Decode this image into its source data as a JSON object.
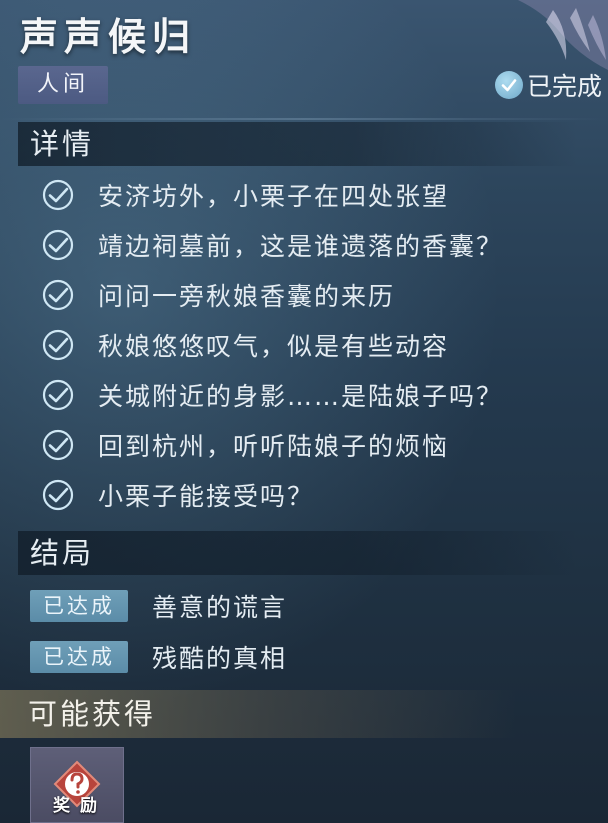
{
  "quest": {
    "title": "声声候归",
    "realm_tag": "人间",
    "status": "已完成"
  },
  "details": {
    "heading": "详情",
    "tasks": [
      {
        "label": "安济坊外，小栗子在四处张望",
        "done": true
      },
      {
        "label": "靖边祠墓前，这是谁遗落的香囊？",
        "done": true
      },
      {
        "label": "问问一旁秋娘香囊的来历",
        "done": true
      },
      {
        "label": "秋娘悠悠叹气，似是有些动容",
        "done": true
      },
      {
        "label": "关城附近的身影……是陆娘子吗？",
        "done": true
      },
      {
        "label": "回到杭州，听听陆娘子的烦恼",
        "done": true
      },
      {
        "label": "小栗子能接受吗？",
        "done": true
      }
    ]
  },
  "endings": {
    "heading": "结局",
    "items": [
      {
        "badge": "已达成",
        "label": "善意的谎言"
      },
      {
        "badge": "已达成",
        "label": "残酷的真相"
      }
    ]
  },
  "rewards": {
    "heading": "可能获得",
    "item_label": "奖励",
    "item_icon": "question-mark-icon"
  },
  "colors": {
    "accent_badge": "#6f9fb8",
    "realm_tag_bg": "#5a678f",
    "check_stroke": "#cfe7f4"
  }
}
